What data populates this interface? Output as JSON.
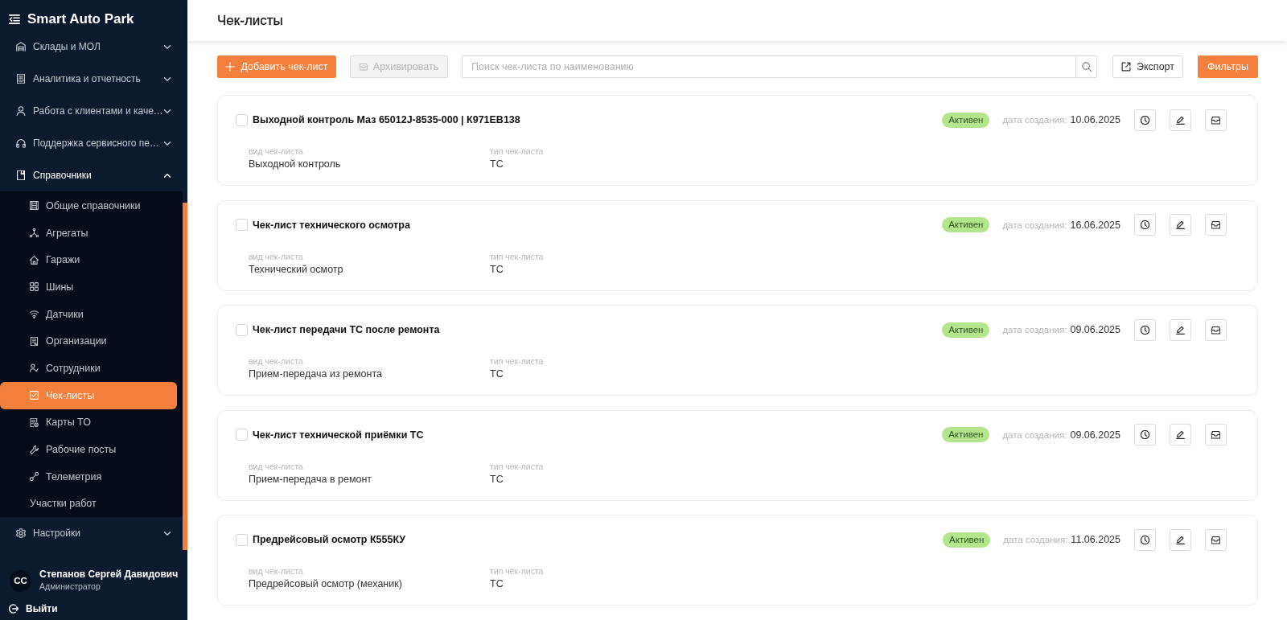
{
  "app": {
    "title": "Smart Auto Park"
  },
  "sidebar": {
    "groups": [
      {
        "label": "Склады и МОЛ",
        "expanded": false
      },
      {
        "label": "Аналитика и отчетность",
        "expanded": false
      },
      {
        "label": "Работа с клиентами и каче…",
        "expanded": false
      },
      {
        "label": "Поддержка сервисного пе…",
        "expanded": false
      },
      {
        "label": "Справочники",
        "expanded": true,
        "children": [
          {
            "label": "Общие справочники",
            "selected": false
          },
          {
            "label": "Агрегаты",
            "selected": false
          },
          {
            "label": "Гаражи",
            "selected": false
          },
          {
            "label": "Шины",
            "selected": false
          },
          {
            "label": "Датчики",
            "selected": false
          },
          {
            "label": "Организации",
            "selected": false
          },
          {
            "label": "Сотрудники",
            "selected": false
          },
          {
            "label": "Чек-листы",
            "selected": true
          },
          {
            "label": "Карты ТО",
            "selected": false
          },
          {
            "label": "Рабочие посты",
            "selected": false
          },
          {
            "label": "Телеметрия",
            "selected": false
          },
          {
            "label": "Участки работ",
            "selected": false
          }
        ]
      },
      {
        "label": "Настройки",
        "expanded": false
      }
    ]
  },
  "user": {
    "initials": "СС",
    "name": "Степанов Сергей Давидович",
    "role": "Администратор"
  },
  "logout": {
    "label": "Выйти"
  },
  "header": {
    "title": "Чек-листы"
  },
  "toolbar": {
    "add_button": {
      "label": "Добавить чек-лист"
    },
    "archive_button": {
      "label": "Архивировать",
      "disabled": true
    },
    "search": {
      "placeholder": "Поиск чек-листа по наименованию"
    },
    "export_button": {
      "label": "Экспорт"
    },
    "filters_button": {
      "label": "Фильтры"
    }
  },
  "checklists": [
    {
      "title": "Выходной контроль Маз 65012J-8535-000 | К971ЕВ138",
      "checked": false,
      "status": "Активен",
      "date_label": "дата создания:",
      "date": "10.06.2025",
      "fields": [
        {
          "label": "вид чек-листа",
          "value": "Выходной контроль"
        },
        {
          "label": "тип чек-листа",
          "value": "ТС"
        }
      ]
    },
    {
      "title": "Чек-лист технического осмотра",
      "checked": false,
      "status": "Активен",
      "date_label": "дата создания:",
      "date": "16.06.2025",
      "fields": [
        {
          "label": "вид чек-листа",
          "value": "Технический осмотр"
        },
        {
          "label": "тип чек-листа",
          "value": "ТС"
        }
      ]
    },
    {
      "title": "Чек-лист передачи ТС после ремонта",
      "checked": false,
      "status": "Активен",
      "date_label": "дата создания:",
      "date": "09.06.2025",
      "fields": [
        {
          "label": "вид чек-листа",
          "value": "Прием-передача из ремонта"
        },
        {
          "label": "тип чек-листа",
          "value": "ТС"
        }
      ]
    },
    {
      "title": "Чек-лист технической приёмки ТС",
      "checked": false,
      "status": "Активен",
      "date_label": "дата создания:",
      "date": "09.06.2025",
      "fields": [
        {
          "label": "вид чек-листа",
          "value": "Прием-передача в ремонт"
        },
        {
          "label": "тип чек-листа",
          "value": "ТС"
        }
      ]
    },
    {
      "title": "Предрейсовый осмотр К555КУ",
      "checked": false,
      "status": "Активен",
      "date_label": "дата создания:",
      "date": "11.06.2025",
      "fields": [
        {
          "label": "вид чек-листа",
          "value": "Предрейсовый осмотр (механик)"
        },
        {
          "label": "тип чек-листа",
          "value": "ТС"
        }
      ]
    }
  ]
}
